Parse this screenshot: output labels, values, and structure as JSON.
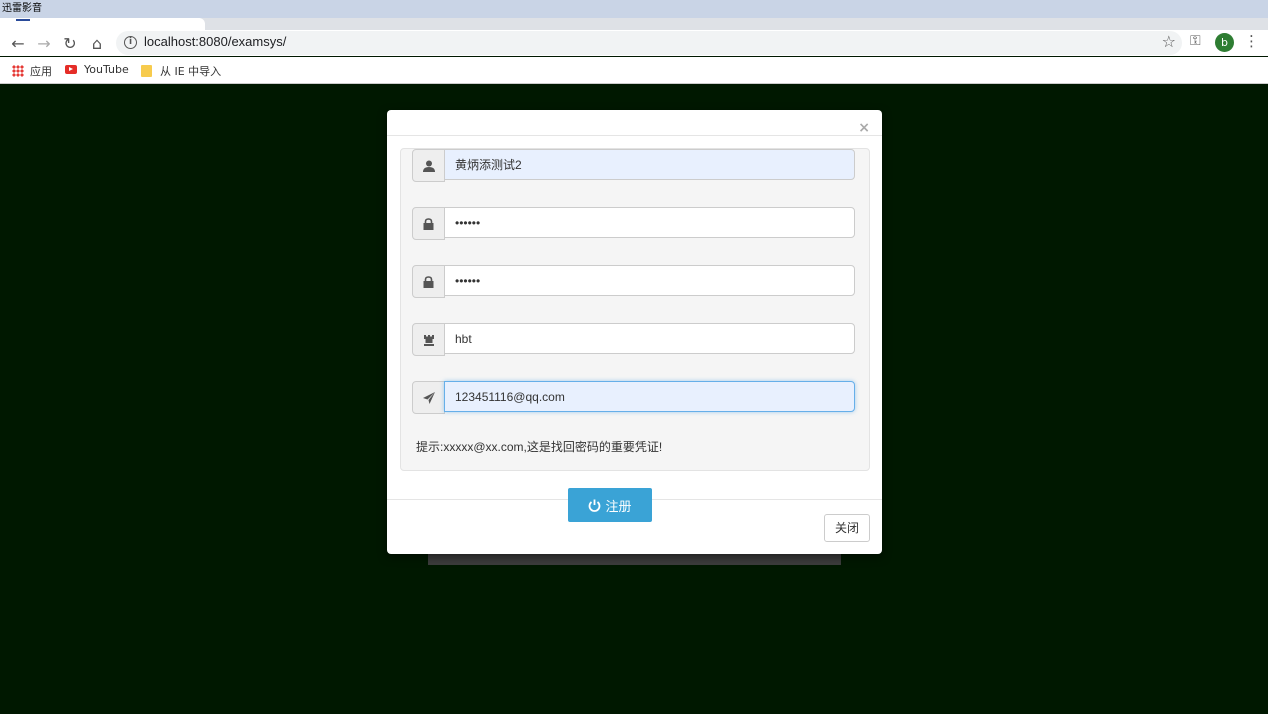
{
  "window": {
    "title": "迅雷影音"
  },
  "browser": {
    "url": "localhost:8080/examsys/",
    "profile_initial": "b",
    "bookmarks": [
      "应用",
      "YouTube",
      "从 IE 中导入"
    ]
  },
  "modal": {
    "close_glyph": "×",
    "fields": {
      "username": "黄炳添测试2",
      "password": "••••••",
      "confirm_password": "••••••",
      "nickname": "hbt",
      "email": "123451116@qq.com"
    },
    "hint": "提示:xxxxx@xx.com,这是找回密码的重要凭证!",
    "register_label": "注册",
    "close_label": "关闭"
  }
}
